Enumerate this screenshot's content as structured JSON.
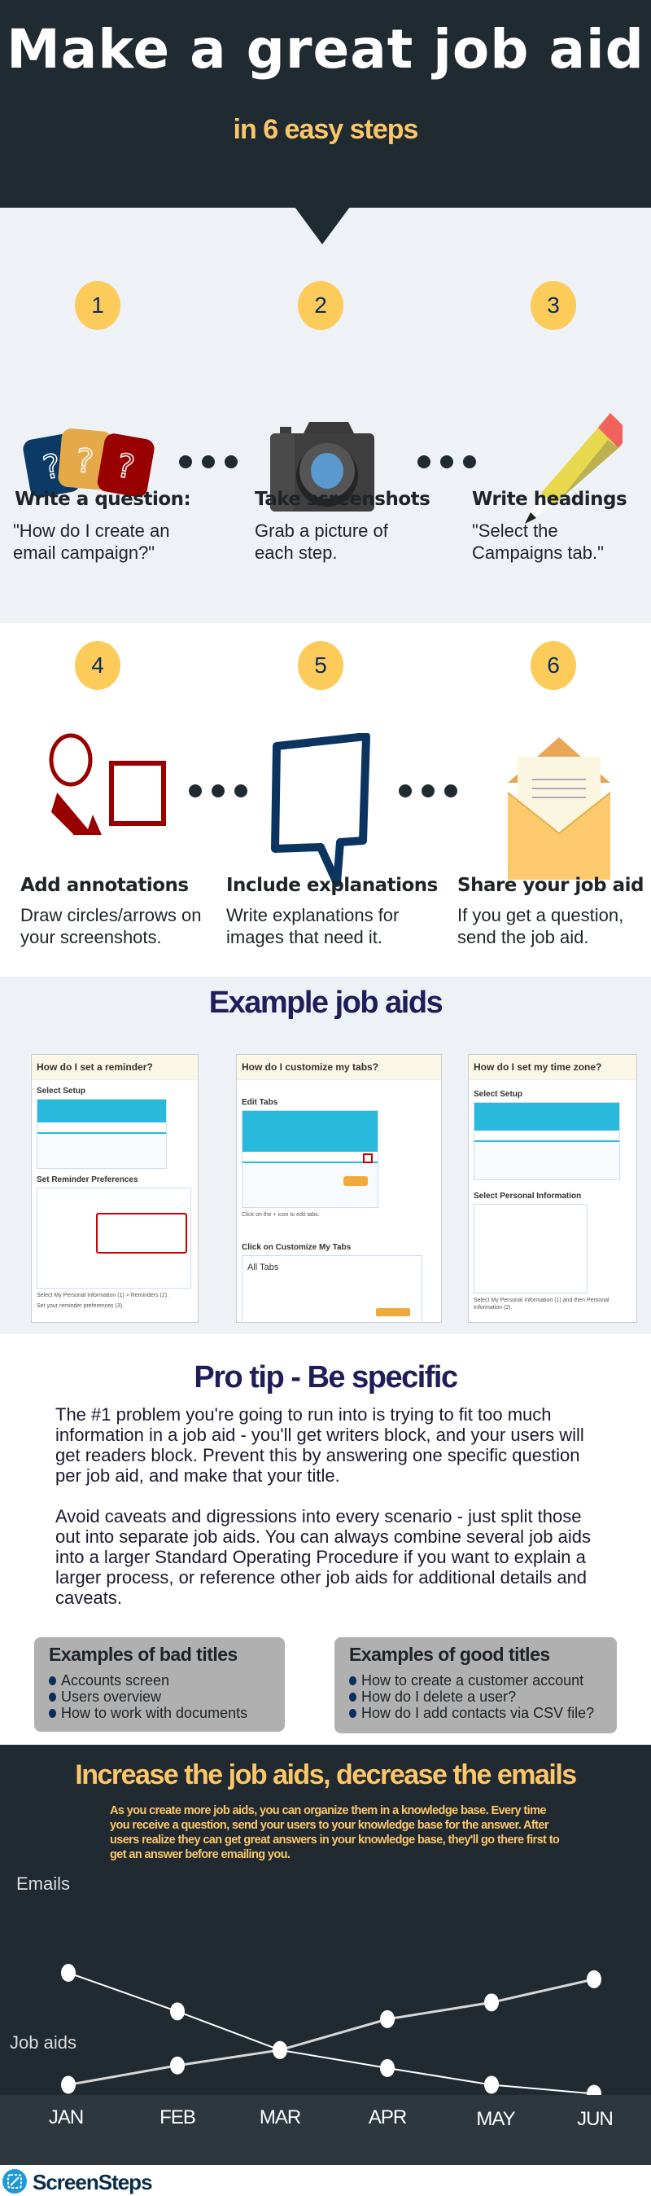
{
  "header": {
    "title": "Make a great job aid",
    "subtitle": "in 6 easy steps"
  },
  "steps": [
    {
      "number": "1",
      "heading": "Write a question:",
      "desc": "\"How do I create an email campaign?\"",
      "icon": "question-cards-icon"
    },
    {
      "number": "2",
      "heading": "Take screenshots",
      "desc": "Grab a picture of each step.",
      "icon": "camera-icon"
    },
    {
      "number": "3",
      "heading": "Write headings",
      "desc": "\"Select the Campaigns tab.\"",
      "icon": "pencil-icon"
    },
    {
      "number": "4",
      "heading": "Add annotations",
      "desc": "Draw circles/arrows on your screenshots.",
      "icon": "annotation-shapes-icon"
    },
    {
      "number": "5",
      "heading": "Include explanations",
      "desc": "Write explanations for images that need it.",
      "icon": "speech-bubble-icon"
    },
    {
      "number": "6",
      "heading": "Share your job aid",
      "desc": "If you get a question, send the job aid.",
      "icon": "envelope-icon"
    }
  ],
  "examples": {
    "title": "Example job aids",
    "cards": [
      {
        "title": "How do I set a reminder?",
        "sections": [
          "Select Setup",
          "Set Reminder Preferences"
        ],
        "captions": [
          "Select My Personal Information (1) > Reminders (2).",
          "Set your reminder preferences (3)."
        ]
      },
      {
        "title": "How do I customize my tabs?",
        "sections": [
          "Edit Tabs",
          "Click on Customize My Tabs"
        ],
        "captions": [
          "Click on the + icon to edit tabs."
        ],
        "inner_title": "All Tabs"
      },
      {
        "title": "How do I set my time zone?",
        "sections": [
          "Select Setup",
          "Select Personal Information"
        ],
        "captions": [
          "Select My Personal Information (1) and then Personal Information (2)."
        ]
      }
    ]
  },
  "protip": {
    "title": "Pro tip - Be specific",
    "paragraphs": [
      "The #1 problem you're going to run into is trying to fit too much information in a job aid - you'll get writers block, and your users will get readers block. Prevent this by answering one specific question per job aid, and make that your title.",
      "Avoid caveats and digressions into every scenario - just split those out into separate job aids. You can always combine several job aids into a larger Standard Operating Procedure if you want to explain a larger process, or reference other job aids for additional details and caveats."
    ],
    "bad": {
      "title": "Examples of bad titles",
      "items": [
        "Accounts screen",
        "Users overview",
        "How to work with documents"
      ]
    },
    "good": {
      "title": "Examples of good titles",
      "items": [
        "How to create a customer account",
        "How do I delete a user?",
        "How do I add contacts via CSV file?"
      ]
    }
  },
  "chart_data": {
    "type": "line",
    "title": "Increase the job aids, decrease the emails",
    "subtitle": "As you create more  job aids, you can organize them in a knowledge base. Every time you receive a question, send your users to your knowledge base for the answer. After users realize they can get great answers in your knowledge base, they'll go there first to get an answer before emailing you.",
    "categories": [
      "JAN",
      "FEB",
      "MAR",
      "APR",
      "MAY",
      "JUN"
    ],
    "series": [
      {
        "name": "Emails",
        "values": [
          10,
          7,
          4,
          2.6,
          1.3,
          0.6
        ]
      },
      {
        "name": "Job aids",
        "values": [
          1.3,
          2.8,
          4,
          6.4,
          7.7,
          9.5
        ]
      }
    ],
    "ylim": [
      0,
      10.5
    ],
    "grid": false,
    "line_color": "#ffffff"
  },
  "footer": {
    "brand": "ScreenSteps",
    "brand_color": "#1f9ad6"
  },
  "colors": {
    "dark": "#202a31",
    "accent": "#fcc76a",
    "light_bg": "#eef1f5",
    "navy": "#1f1d5a"
  }
}
